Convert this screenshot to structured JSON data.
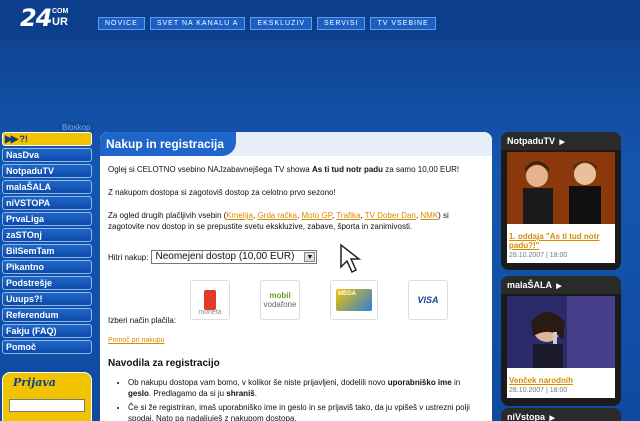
{
  "header": {
    "logo": {
      "big": "24",
      "com": "COM",
      "ur": "UR"
    },
    "nav": [
      "NOVICE",
      "SVET NA KANALU A",
      "EKSKLUZIV",
      "SERVISI",
      "TV VSEBINE"
    ]
  },
  "sidebar": {
    "bioskop": "Bioskop",
    "top_item": "?!",
    "items": [
      "NasDva",
      "NotpaduTV",
      "malaŠALA",
      "niVSTOPA",
      "PrvaLiga",
      "zaSTOnj",
      "BilSemTam",
      "Pikantno",
      "Podstrešje",
      "Uuups?!",
      "Referendum",
      "Fakju (FAQ)",
      "Pomoč"
    ],
    "prijava": "Prijava"
  },
  "main": {
    "title": "Nakup in registracija",
    "p1_a": "Oglej si CELOTNO vsebino NAJzabavnejšega TV showa ",
    "p1_b": "As ti tud notr padu",
    "p1_c": " za samo 10,00 EUR!",
    "p2": "Z nakupom dostopa si zagotoviš dostop za celotno prvo sezono!",
    "p3_a": "Za ogled drugih plačljivih vsebin (",
    "links": [
      "Kmetija",
      "Grda račka",
      "Moto GP",
      "Trafika",
      "TV Dober Dan",
      "NMK"
    ],
    "p3_b": ") si zagotovite nov dostop in se prepustite svetu ekskluzive, zabave, športa in zanimivosti.",
    "hitri_label": "Hitri nakup:",
    "hitri_value": "Neomejeni dostop (10,00 EUR)",
    "payments": {
      "moneta": "moneta",
      "mobil": "mobil",
      "mobil_sub": "vodafone",
      "mega": "MEGA",
      "visa": "VISA"
    },
    "izberi": "Izberi način plačila:",
    "pomoc": "Pomoč pri nakupu",
    "navodila_title": "Navodila za registracijo",
    "b1_a": "Ob nakupu dostopa vam bomo, v kolikor še niste prijavljeni, dodelili novo ",
    "b1_b": "uporabniško ime",
    "b1_c": " in ",
    "b1_d": "geslo",
    "b1_e": ". Predlagamo da si ju ",
    "b1_f": "shraniš",
    "b1_g": ".",
    "b2": "Če si že registriran, imaš uporabniško ime in geslo in se prijaviš tako, da ju vpišeš v ustrezni polji spodaj. Nato pa nadaljuješ z nakupom dostopa."
  },
  "right": {
    "box1": {
      "title": "NotpaduTV",
      "caption": "1. oddaja \"As ti tud notr padu?!\"",
      "date": "28.10.2007 | 18:00"
    },
    "box2": {
      "title": "malaŠALA",
      "caption": "Venček narodnih",
      "date": "28.10.2007 | 18:00"
    },
    "box3": {
      "title": "niVstopa"
    }
  }
}
